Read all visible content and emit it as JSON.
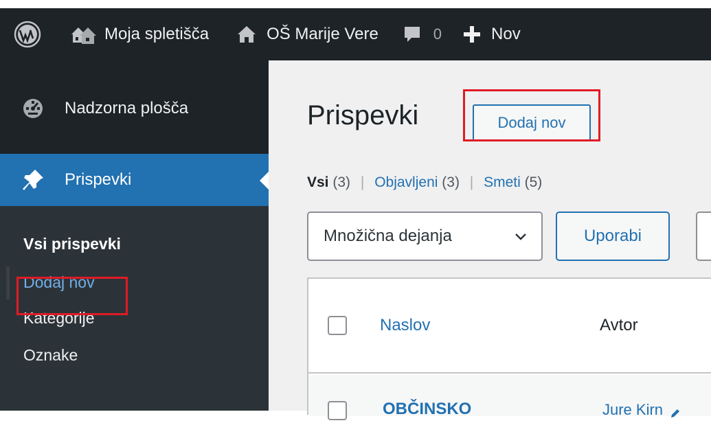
{
  "adminbar": {
    "my_sites_label": "Moja spletišča",
    "site_label": "OŠ Marije Vere",
    "comments_count": "0",
    "new_label": "Nov",
    "icons": {
      "logo": "wordpress-logo-icon",
      "sites": "my-sites-icon",
      "home": "home-icon",
      "comments": "comment-icon",
      "new": "plus-icon"
    }
  },
  "sidebar": {
    "dashboard_label": "Nadzorna plošča",
    "posts_label": "Prispevki",
    "submenu": [
      {
        "label": "Vsi prispevki",
        "current": true
      },
      {
        "label": "Dodaj nov",
        "highlighted": true
      },
      {
        "label": "Kategorije"
      },
      {
        "label": "Oznake"
      }
    ],
    "icons": {
      "dashboard": "dashboard-gauge-icon",
      "posts": "pushpin-icon"
    }
  },
  "main": {
    "page_title": "Prispevki",
    "add_new_label": "Dodaj nov",
    "views": [
      {
        "label": "Vsi",
        "count": "(3)",
        "current": true
      },
      {
        "label": "Objavljeni",
        "count": "(3)"
      },
      {
        "label": "Smeti",
        "count": "(5)"
      }
    ],
    "bulk_actions": {
      "selected": "Množična dejanja"
    },
    "apply_label": "Uporabi",
    "table": {
      "columns": [
        "Naslov",
        "Avtor"
      ],
      "rows": [
        {
          "title": "OBČINSKO",
          "author": "Jure Kirn"
        }
      ]
    }
  },
  "colors": {
    "adminbar_bg": "#1d2327",
    "accent_blue": "#2271b1",
    "highlight_red": "#e01b24",
    "submenu_bg": "#2c3338",
    "link_blue": "#72aee6"
  }
}
